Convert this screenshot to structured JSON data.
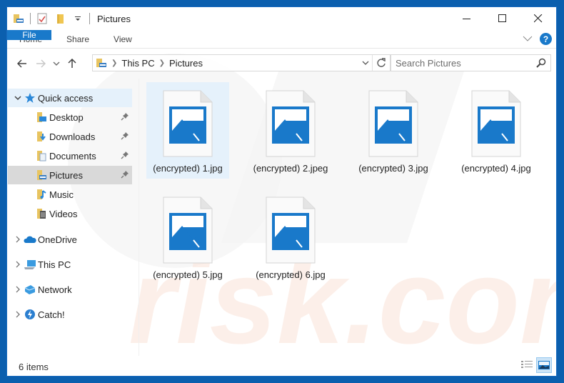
{
  "window": {
    "title": "Pictures",
    "controls": {
      "minimize": "minimize",
      "maximize": "maximize",
      "close": "close"
    }
  },
  "quick_access_toolbar": {
    "icons": [
      "folder-properties-icon",
      "properties-check-icon",
      "new-folder-icon",
      "customize-dropdown-icon"
    ]
  },
  "ribbon": {
    "tabs": [
      {
        "label": "File",
        "active": true
      },
      {
        "label": "Home"
      },
      {
        "label": "Share"
      },
      {
        "label": "View"
      }
    ],
    "help_label": "?"
  },
  "navigation": {
    "breadcrumb": [
      "This PC",
      "Pictures"
    ],
    "search_placeholder": "Search Pictures"
  },
  "sidebar": {
    "quick_access": {
      "label": "Quick access",
      "expanded": true
    },
    "pinned": [
      {
        "label": "Desktop",
        "pinned": true
      },
      {
        "label": "Downloads",
        "pinned": true
      },
      {
        "label": "Documents",
        "pinned": true
      },
      {
        "label": "Pictures",
        "pinned": true,
        "selected": true
      },
      {
        "label": "Music",
        "pinned": false
      },
      {
        "label": "Videos",
        "pinned": false
      }
    ],
    "roots": [
      {
        "label": "OneDrive"
      },
      {
        "label": "This PC"
      },
      {
        "label": "Network"
      },
      {
        "label": "Catch!"
      }
    ]
  },
  "files": [
    {
      "name": "(encrypted) 1.jpg",
      "selected": true
    },
    {
      "name": "(encrypted) 2.jpeg"
    },
    {
      "name": "(encrypted) 3.jpg"
    },
    {
      "name": "(encrypted) 4.jpg"
    },
    {
      "name": "(encrypted) 5.jpg"
    },
    {
      "name": "(encrypted) 6.jpg"
    }
  ],
  "status": {
    "item_count": "6 items"
  },
  "colors": {
    "accent": "#1979ca",
    "selection": "#e5f1fb",
    "selected_nav": "#d9d9d9",
    "frame": "#0b5fae"
  }
}
